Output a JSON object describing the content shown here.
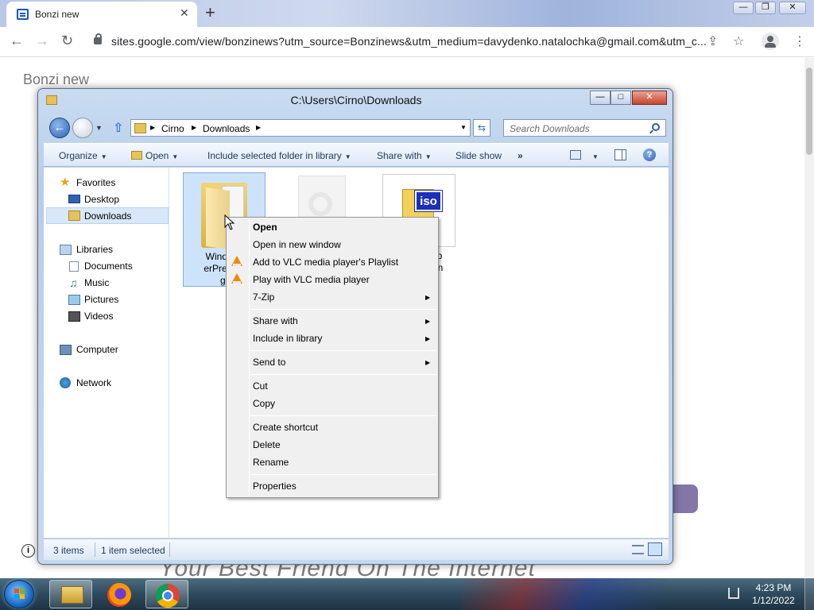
{
  "browser": {
    "tab_title": "Bonzi new",
    "tab_close": "✕",
    "new_tab": "+",
    "url": "sites.google.com/view/bonzinews?utm_source=Bonzinews&utm_medium=davydenko.natalochka@gmail.com&utm_c...",
    "window_controls": {
      "minimize": "—",
      "restore": "❐",
      "close": "✕"
    },
    "nav": {
      "back": "←",
      "forward": "→",
      "reload": "↻"
    },
    "toolbar_icons": {
      "share": "⇪",
      "star": "☆",
      "menu": "⋮"
    }
  },
  "page": {
    "heading": "Bonzi new",
    "banner_text": "Your Best Friend On The Internet",
    "info": "i"
  },
  "explorer": {
    "title": "C:\\Users\\Cirno\\Downloads",
    "controls": {
      "minimize": "—",
      "maximize": "□",
      "close": "✕"
    },
    "breadcrumbs": [
      "Cirno",
      "Downloads"
    ],
    "search_placeholder": "Search Downloads",
    "commands": {
      "organize": "Organize",
      "open": "Open",
      "include": "Include selected folder in library",
      "share": "Share with",
      "slideshow": "Slide show",
      "more": "»"
    },
    "help": "?",
    "nav_pane": {
      "favorites": "Favorites",
      "desktop": "Desktop",
      "downloads": "Downloads",
      "libraries": "Libraries",
      "documents": "Documents",
      "music": "Music",
      "pictures": "Pictures",
      "videos": "Videos",
      "computer": "Computer",
      "network": "Network"
    },
    "files": {
      "folder_label_lines": [
        "Windows",
        "erPreview",
        "gli"
      ],
      "iso_label_lines": [
        "elop",
        "ntEn"
      ],
      "iso_tag": "iso"
    },
    "status": {
      "items": "3 items",
      "selected": "1 item selected"
    }
  },
  "context_menu": {
    "open": "Open",
    "open_new_window": "Open in new window",
    "vlc_playlist": "Add to VLC media player's Playlist",
    "vlc_play": "Play with VLC media player",
    "seven_zip": "7-Zip",
    "share_with": "Share with",
    "include_library": "Include in library",
    "send_to": "Send to",
    "cut": "Cut",
    "copy": "Copy",
    "create_shortcut": "Create shortcut",
    "delete": "Delete",
    "rename": "Rename",
    "properties": "Properties",
    "submenu_arrow": "▶"
  },
  "taskbar": {
    "time": "4:23 PM",
    "date": "1/12/2022"
  },
  "colors": {
    "explorer_frame": "#b6cde9",
    "selection": "#cde3fb",
    "taskbar": "#2d4a5c",
    "vlc_orange": "#f08a00"
  }
}
